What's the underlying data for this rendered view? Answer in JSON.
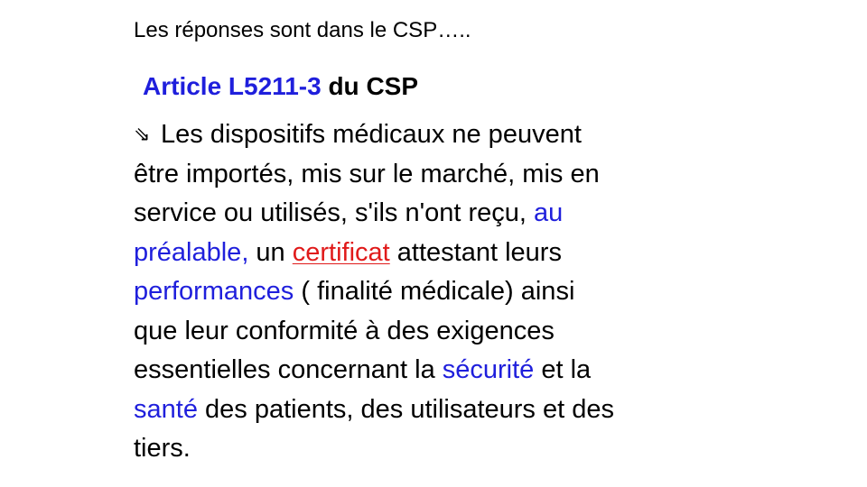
{
  "intro": "Les réponses sont dans le CSP…..",
  "heading": {
    "article_ref": "Article L5211-3",
    "suffix": " du CSP"
  },
  "bullet_icon": "arrow-icon",
  "body": {
    "l1": "Les dispositifs médicaux ne peuvent",
    "l2": "être importés, mis sur le marché, mis en",
    "l3a": "service ou utilisés, s'ils n'ont reçu, ",
    "l3b": "au",
    "l4a": "préalable,",
    "l4b": " un ",
    "l4c": "certificat",
    "l4d": " attestant leurs",
    "l5a": "performances",
    "l5b": " ( finalité médicale) ainsi",
    "l6": "que leur conformité à des exigences",
    "l7a": "essentielles concernant la ",
    "l7b": "sécurité",
    "l7c": " et la",
    "l8a": "santé",
    "l8b": " des patients, des utilisateurs et des",
    "l9": "tiers."
  },
  "colors": {
    "emphasis_blue": "#1f1fdc",
    "emphasis_red": "#e01a1a",
    "text": "#000000"
  }
}
